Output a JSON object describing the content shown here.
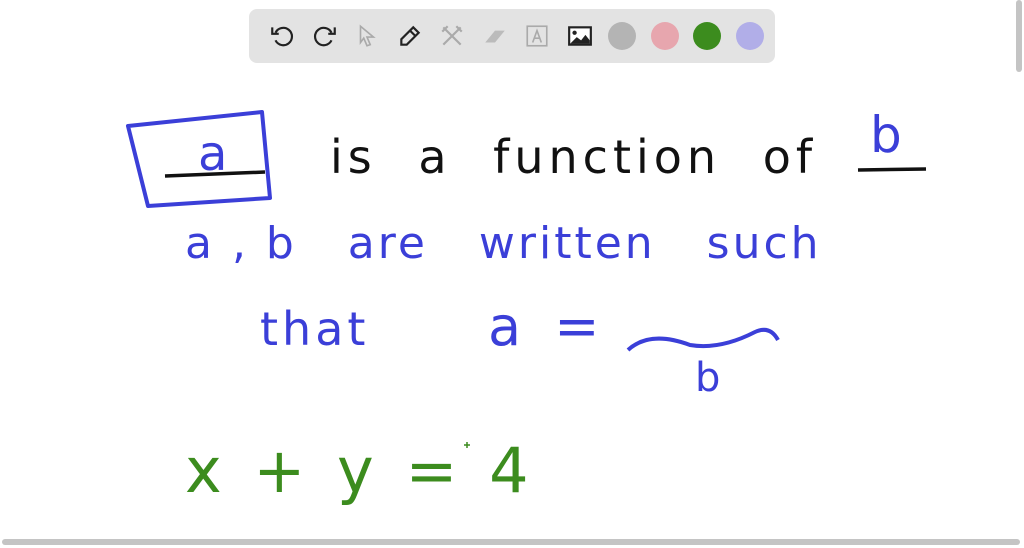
{
  "toolbar": {
    "tools": [
      {
        "icon": "undo-icon"
      },
      {
        "icon": "redo-icon"
      },
      {
        "icon": "select-arrow-icon"
      },
      {
        "icon": "pencil-icon"
      },
      {
        "icon": "tools-icon"
      },
      {
        "icon": "eraser-icon"
      },
      {
        "icon": "text-icon"
      },
      {
        "icon": "image-icon"
      }
    ],
    "colors": [
      "#b4b4b4",
      "#e7a6ae",
      "#3c8c1e",
      "#b1aee8"
    ]
  },
  "board": {
    "line1": {
      "a": "a",
      "middle": "is a function of",
      "b": "b"
    },
    "line2": "a , b   are   written   such",
    "line3": {
      "that": "that",
      "eq": "a =",
      "b": "b"
    },
    "line4": "x + y = 4"
  },
  "colors": {
    "blue": "#3b3fd8",
    "black": "#111111",
    "green": "#3c8c1e"
  }
}
